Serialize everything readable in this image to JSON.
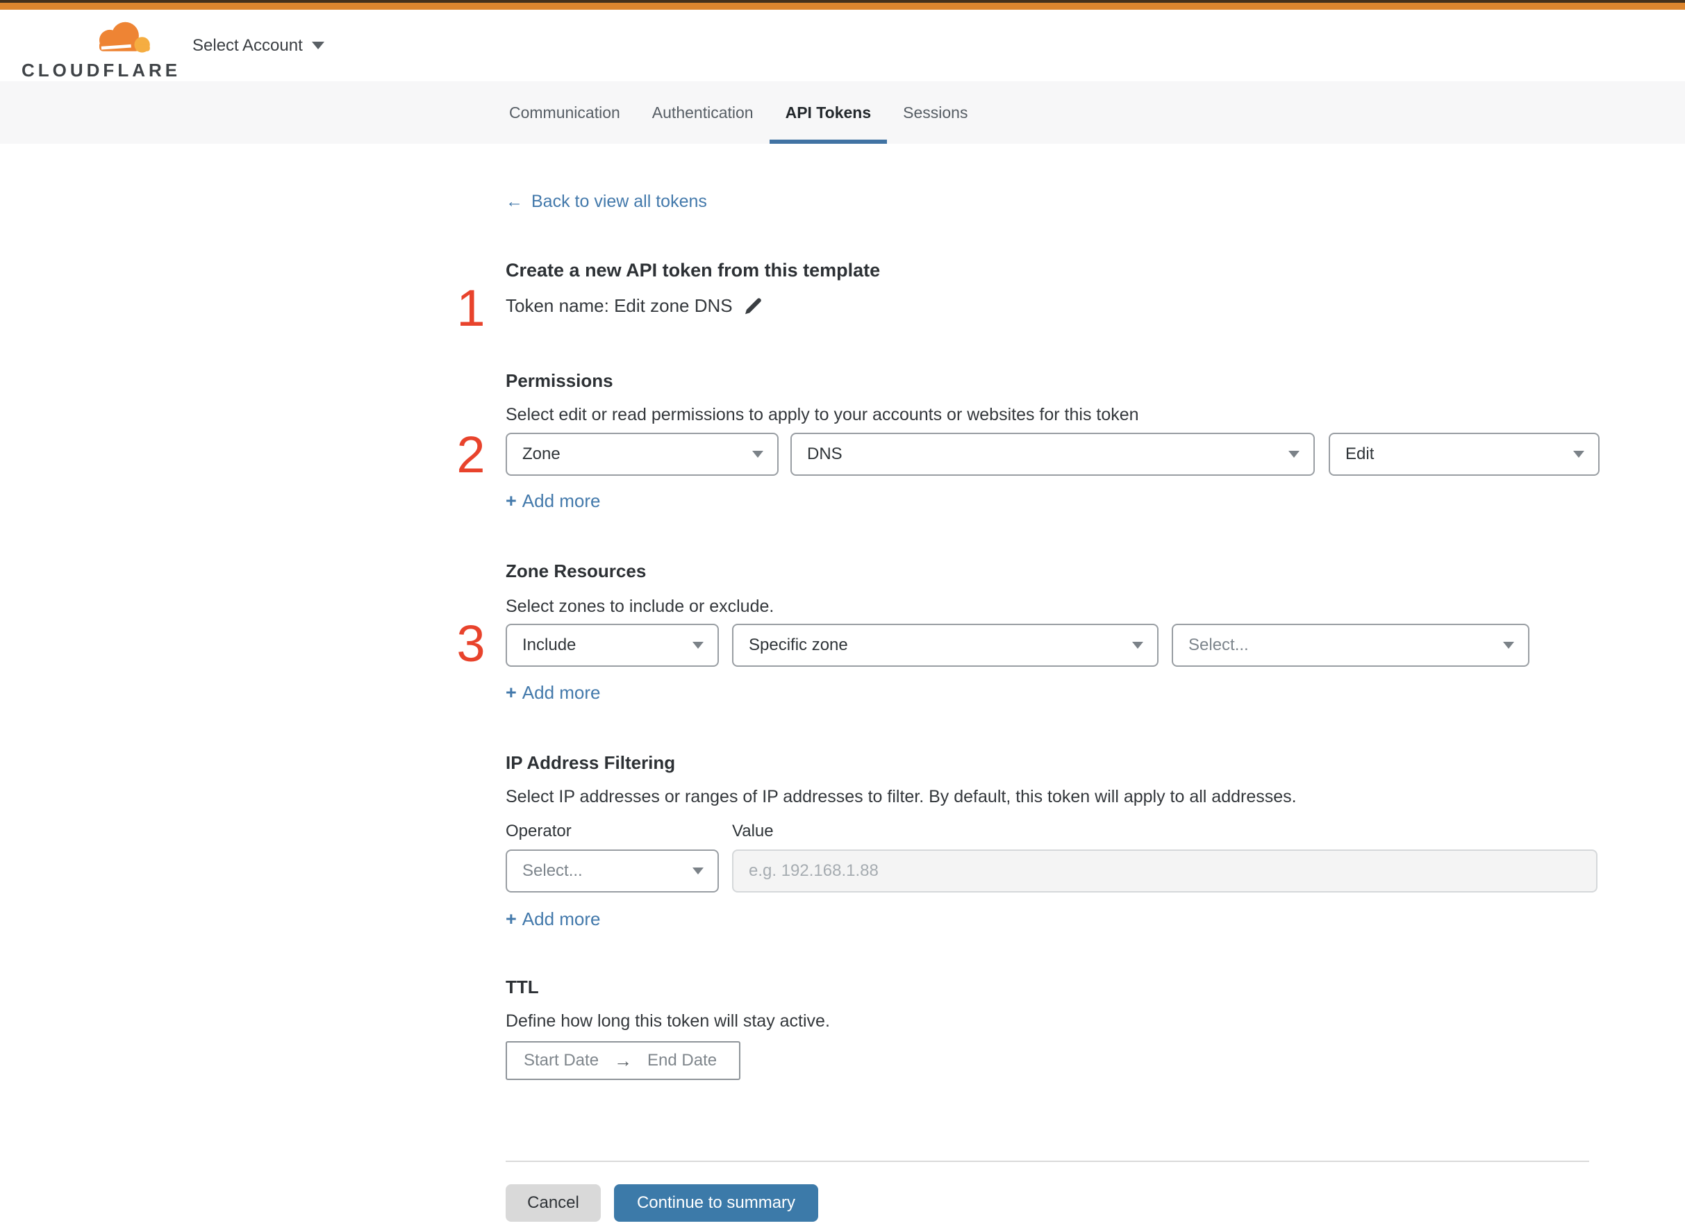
{
  "colors": {
    "top-strip-dark": "#44311c",
    "top-strip-orange": "#dd862e",
    "link-blue": "#4379ab",
    "tab-underline-blue": "#4173a3",
    "primary-button-blue": "#3c7aa9",
    "annotation-red": "#e8432c",
    "border-gray": "#999ea3",
    "placeholder-gray": "#7d858c",
    "divider-gray": "#d9d9d9",
    "tabbar-bg": "#f7f7f8",
    "cancel-bg": "#d9d9d9",
    "input-disabled-bg": "#f4f4f4",
    "input-disabled-border": "#d5d8da",
    "brand-orange": "#ee8434",
    "brand-orange-light": "#f5ad41"
  },
  "header": {
    "logo_text": "CLOUDFLARE",
    "account_selector_label": "Select Account"
  },
  "tabs": [
    {
      "label": "Communication"
    },
    {
      "label": "Authentication"
    },
    {
      "label": "API Tokens"
    },
    {
      "label": "Sessions"
    }
  ],
  "back_link": {
    "arrow": "←",
    "label": "Back to view all tokens"
  },
  "annotations": {
    "step1": "1",
    "step2": "2",
    "step3": "3"
  },
  "template_section": {
    "title": "Create a new API token from this template",
    "token_name_line": "Token name: Edit zone DNS"
  },
  "permissions": {
    "heading": "Permissions",
    "description": "Select edit or read permissions to apply to your accounts or websites for this token",
    "scope_value": "Zone",
    "service_value": "DNS",
    "access_value": "Edit",
    "plus": "+",
    "add_more_label": "Add more"
  },
  "zone_resources": {
    "heading": "Zone Resources",
    "description": "Select zones to include or exclude.",
    "mode_value": "Include",
    "type_value": "Specific zone",
    "zone_placeholder": "Select...",
    "plus": "+",
    "add_more_label": "Add more"
  },
  "ip_filtering": {
    "heading": "IP Address Filtering",
    "description": "Select IP addresses or ranges of IP addresses to filter. By default, this token will apply to all addresses.",
    "operator_label": "Operator",
    "value_label": "Value",
    "operator_placeholder": "Select...",
    "value_placeholder": "e.g. 192.168.1.88",
    "plus": "+",
    "add_more_label": "Add more"
  },
  "ttl": {
    "heading": "TTL",
    "description": "Define how long this token will stay active.",
    "start_label": "Start Date",
    "arrow": "→",
    "end_label": "End Date"
  },
  "footer": {
    "cancel_label": "Cancel",
    "continue_label": "Continue to summary"
  }
}
